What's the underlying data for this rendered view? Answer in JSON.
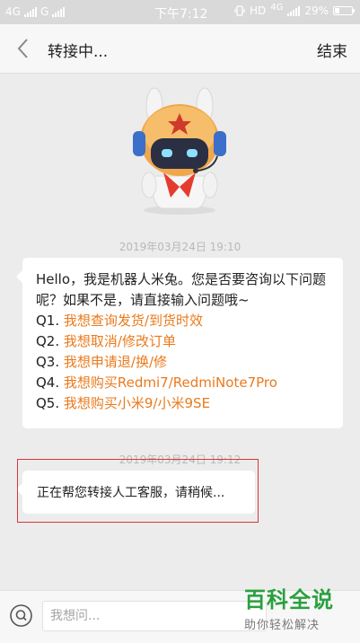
{
  "status_bar": {
    "network_left": "4G",
    "network_mid": "G",
    "time": "下午7:12",
    "hd": "HD",
    "network_right": "4G",
    "battery": "29%",
    "battery_level": 0.29
  },
  "header": {
    "title": "转接中...",
    "end_label": "结束"
  },
  "messages": [
    {
      "timestamp": "2019年03月24日 19:10",
      "intro": "Hello，我是机器人米兔。您是否要咨询以下问题呢？如果不是，请直接输入问题哦~",
      "questions": [
        {
          "prefix": "Q1.",
          "text": "我想查询发货/到货时效"
        },
        {
          "prefix": "Q2.",
          "text": "我想取消/修改订单"
        },
        {
          "prefix": "Q3.",
          "text": "我想申请退/换/修"
        },
        {
          "prefix": "Q4.",
          "text": "我想购买Redmi7/RedmiNote7Pro"
        },
        {
          "prefix": "Q5.",
          "text": "我想购买小米9/小米9SE"
        }
      ]
    },
    {
      "timestamp": "2019年03月24日 19:12",
      "text": "正在帮您转接人工客服，请稍候..."
    }
  ],
  "input": {
    "placeholder": "我想问..."
  },
  "watermark": {
    "title": "百科全说",
    "subtitle": "助你轻松解决"
  },
  "colors": {
    "link": "#e97a1d",
    "highlight_border": "#d9363e",
    "watermark_green": "#2aa03f"
  }
}
